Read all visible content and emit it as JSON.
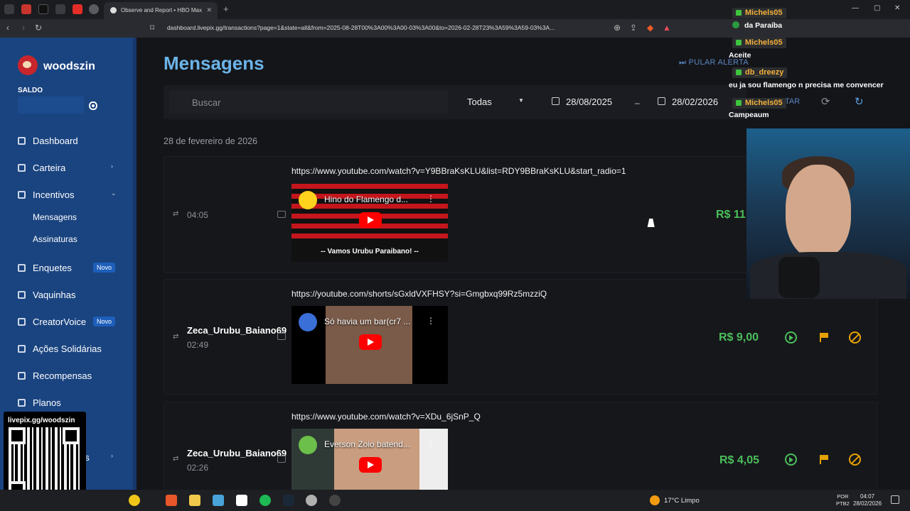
{
  "browser": {
    "tab_title": "Observe and Report • HBO Max",
    "url": "dashboard.livepix.gg/transactions?page=1&state=all&from=2025-08-28T00%3A00%3A00-03%3A00&to=2026-02-28T23%3A59%3A59-03%3A..."
  },
  "sidebar": {
    "brand": "woodszin",
    "saldo_label": "SALDO",
    "items": [
      {
        "label": "Dashboard",
        "icon": "dashboard-icon"
      },
      {
        "label": "Carteira",
        "icon": "bank-icon"
      },
      {
        "label": "Incentivos",
        "icon": "swap-icon"
      },
      {
        "label": "Enquetes",
        "icon": "list-icon",
        "badge": "Novo"
      },
      {
        "label": "Vaquinhas",
        "icon": "piggy-icon"
      },
      {
        "label": "CreatorVoice",
        "icon": "mic-icon",
        "badge": "Novo"
      },
      {
        "label": "Ações Solidárias",
        "icon": "heart-icon"
      },
      {
        "label": "Recompensas",
        "icon": "gift-icon"
      },
      {
        "label": "Planos",
        "icon": "plan-icon"
      },
      {
        "label": "es",
        "icon": "more-icon"
      }
    ],
    "subitems": [
      "Mensagens",
      "Assinaturas"
    ],
    "qr_label": "livepix.gg/woodszin"
  },
  "main": {
    "title": "Mensagens",
    "skip_label": "PULAR ALERTA",
    "search_placeholder": "Buscar",
    "filter_value": "Todas",
    "date_from": "28/08/2025",
    "date_to": "28/02/2026",
    "date_separator": "–",
    "partial_label": "TAR",
    "date_group": "28 de fevereiro de 2026"
  },
  "messages": [
    {
      "name": "",
      "time": "04:05",
      "url": "https://www.youtube.com/watch?v=Y9BBraKsKLU&list=RDY9BBraKsKLU&start_radio=1",
      "video_title": "Hino do Flamengo d...",
      "caption": "-- Vamos Urubu Paraibano! --",
      "amount": "R$ 11,"
    },
    {
      "name": "Zeca_Urubu_Baiano69",
      "time": "02:49",
      "url": "https://youtube.com/shorts/sGxldVXFHSY?si=Gmgbxq99Rz5mzziQ",
      "video_title": "Só havia um bar(cr7 ...",
      "amount": "R$ 9,00"
    },
    {
      "name": "Zeca_Urubu_Baiano69",
      "time": "02:26",
      "url": "https://www.youtube.com/watch?v=XDu_6jSnP_Q",
      "video_title": "Everson Zoio batend...",
      "amount": "R$ 4,05"
    }
  ],
  "chat": [
    {
      "user": "Michels05",
      "text": "da Paraíba"
    },
    {
      "user": "Michels05",
      "text": "Aceite"
    },
    {
      "user": "db_dreezy",
      "text": "eu ja sou flamengo n precisa me convencer"
    },
    {
      "user": "Michels05",
      "text": "Campeaum"
    }
  ],
  "taskbar": {
    "weather": "17°C  Limpo",
    "lang": "POR\nPTB2",
    "time": "04:07",
    "date": "28/02/2026"
  },
  "colors": {
    "sidebar": "#1a4480",
    "accent": "#6cb4e8",
    "amount": "#4bbf5a",
    "warn": "#e5a100"
  }
}
